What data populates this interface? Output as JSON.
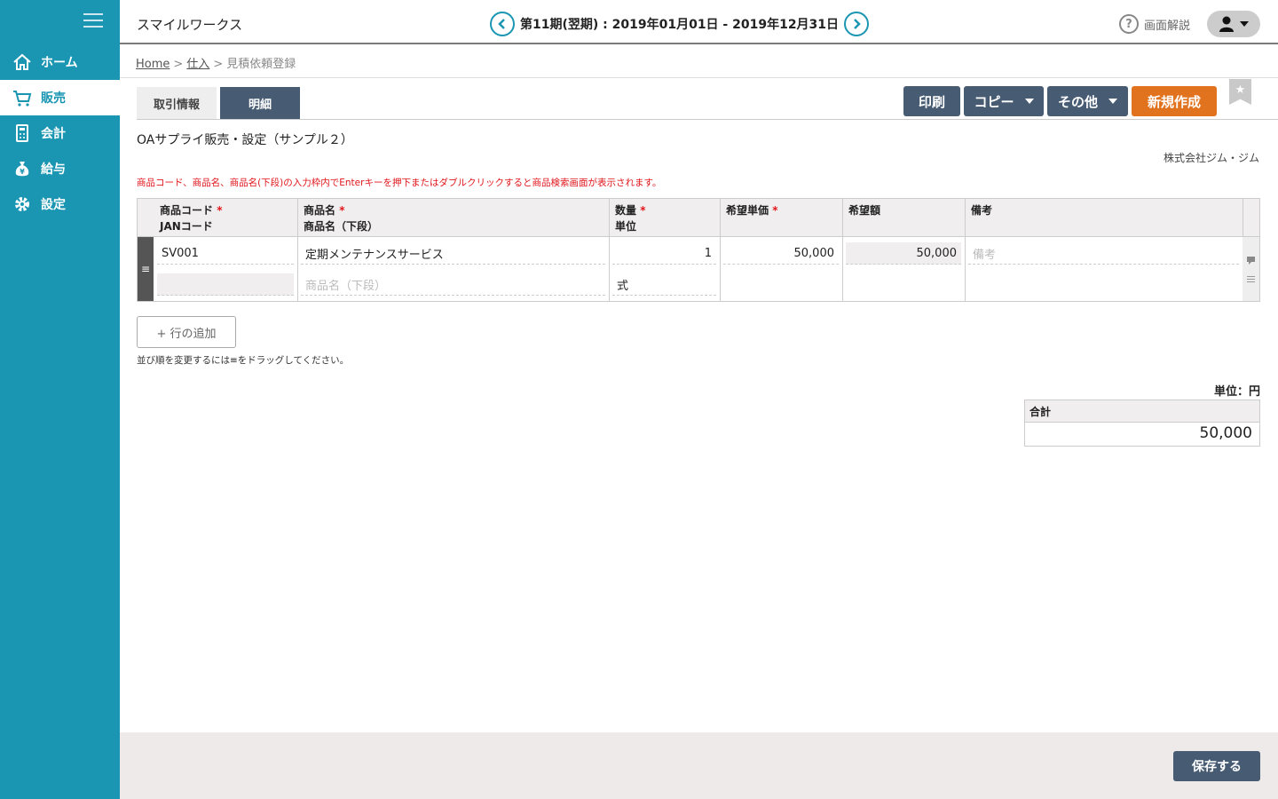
{
  "app": {
    "title": "スマイルワークス"
  },
  "period": {
    "text": "第11期(翌期) : 2019年01月01日 - 2019年12月31日"
  },
  "help": {
    "label": "画面解説"
  },
  "sidebar": {
    "items": [
      {
        "label": "ホーム"
      },
      {
        "label": "販売"
      },
      {
        "label": "会計"
      },
      {
        "label": "給与"
      },
      {
        "label": "設定"
      }
    ]
  },
  "breadcrumb": {
    "home": "Home",
    "section": "仕入",
    "current": "見積依頼登録",
    "sep": ">"
  },
  "tabs": {
    "info": "取引情報",
    "detail": "明細"
  },
  "actions": {
    "print": "印刷",
    "copy": "コピー",
    "other": "その他",
    "new": "新規作成"
  },
  "document": {
    "title": "OAサプライ販売・設定（サンプル２）",
    "company": "株式会社ジム・ジム",
    "notice": "商品コード、商品名、商品名(下段)の入力枠内でEnterキーを押下またはダブルクリックすると商品検索画面が表示されます。"
  },
  "table": {
    "headers": {
      "code": "商品コード",
      "jan": "JANコード",
      "name": "商品名",
      "name_sub": "商品名（下段）",
      "qty": "数量",
      "unit": "単位",
      "unit_price": "希望単価",
      "amount": "希望額",
      "memo": "備考",
      "required_mark": "*"
    },
    "rows": [
      {
        "code": "SV001",
        "jan": "",
        "name": "定期メンテナンスサービス",
        "name_sub_placeholder": "商品名（下段）",
        "qty": "1",
        "unit": "式",
        "unit_price": "50,000",
        "amount": "50,000",
        "memo_placeholder": "備考"
      }
    ]
  },
  "add_row": {
    "label": "+ 行の追加"
  },
  "drag_note": "並び順を変更するには≡をドラッグしてください。",
  "summary": {
    "unit_label": "単位：円",
    "total_label": "合計",
    "total_value": "50,000"
  },
  "footer": {
    "save": "保存する"
  }
}
